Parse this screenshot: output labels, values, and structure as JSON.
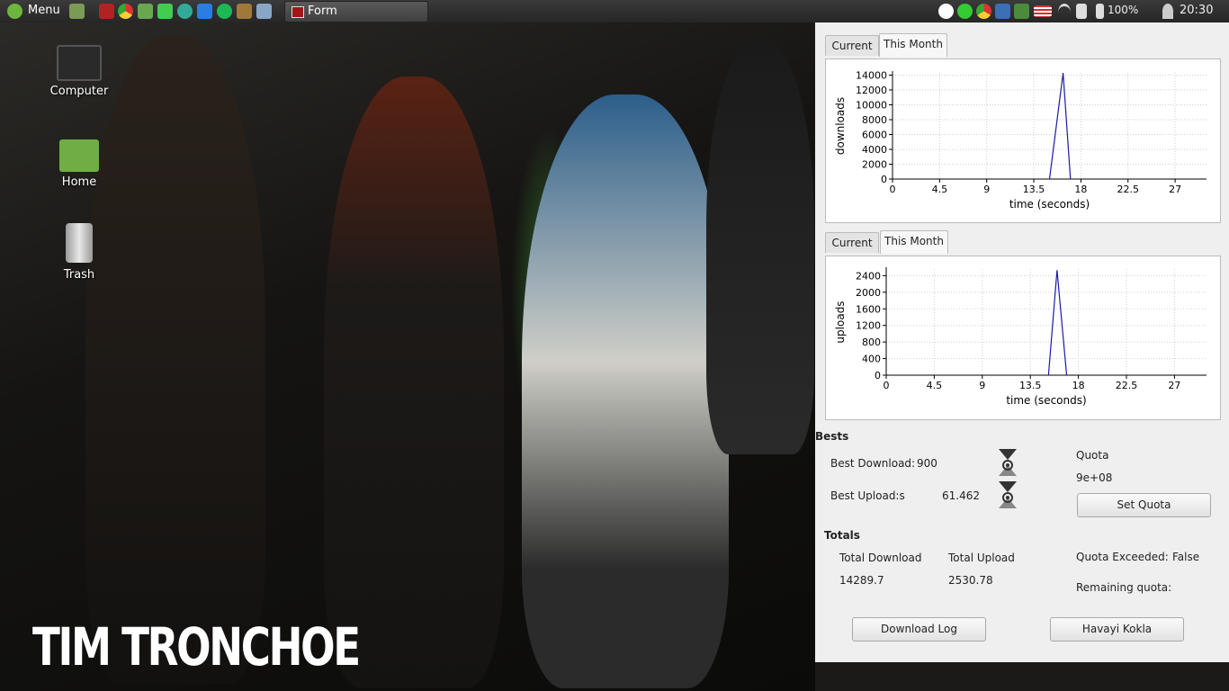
{
  "taskbar": {
    "menu_label": "Menu",
    "window_title": "Form",
    "battery": "100%",
    "clock": "20:30"
  },
  "desktop": {
    "icons": [
      {
        "label": "Computer",
        "icon": "computer-icon"
      },
      {
        "label": "Home",
        "icon": "home-folder-icon"
      },
      {
        "label": "Trash",
        "icon": "trash-icon"
      }
    ],
    "wallpaper_text": "TIM TRONCHOE"
  },
  "downloads_panel": {
    "tabs": [
      "Current",
      "This Month"
    ],
    "active_tab": "This Month"
  },
  "uploads_panel": {
    "tabs": [
      "Current",
      "This Month"
    ],
    "active_tab": "This Month"
  },
  "chart_data": [
    {
      "type": "line",
      "xlabel": "time (seconds)",
      "ylabel": "downloads",
      "x_ticks": [
        "0",
        "4.5",
        "9",
        "13.5",
        "18",
        "22.5",
        "27"
      ],
      "y_ticks": [
        "0",
        "2000",
        "4000",
        "6000",
        "8000",
        "10000",
        "12000",
        "14000"
      ],
      "xlim": [
        0,
        30
      ],
      "ylim": [
        0,
        14300
      ],
      "grid": true,
      "series": [
        {
          "color": "#1a1aa8",
          "x": [
            15,
            16.3,
            17
          ],
          "y": [
            0,
            14289.7,
            0
          ]
        }
      ]
    },
    {
      "type": "line",
      "xlabel": "time (seconds)",
      "ylabel": "uploads",
      "x_ticks": [
        "0",
        "4.5",
        "9",
        "13.5",
        "18",
        "22.5",
        "27"
      ],
      "y_ticks": [
        "0",
        "400",
        "800",
        "1200",
        "1600",
        "2000",
        "2400"
      ],
      "xlim": [
        0,
        30
      ],
      "ylim": [
        0,
        2560
      ],
      "grid": true,
      "series": [
        {
          "color": "#1a1aa8",
          "x": [
            15.2,
            16,
            16.9
          ],
          "y": [
            0,
            2530.78,
            0
          ]
        }
      ]
    }
  ],
  "bests": {
    "heading": "Bests",
    "best_download_label": "Best Download:",
    "best_download_value": "900",
    "best_upload_label": "Best Upload:s",
    "best_upload_value": "61.462"
  },
  "quota": {
    "label": "Quota",
    "value": "9e+08",
    "set_button": "Set Quota",
    "exceeded_label": "Quota Exceeded:",
    "exceeded_value": "False",
    "remaining_label": "Remaining quota:"
  },
  "totals": {
    "heading": "Totals",
    "download_label": "Total Download",
    "download_value": "14289.7",
    "upload_label": "Total Upload",
    "upload_value": "2530.78"
  },
  "buttons": {
    "download_log": "Download Log",
    "extra": "Havayi Kokla"
  }
}
